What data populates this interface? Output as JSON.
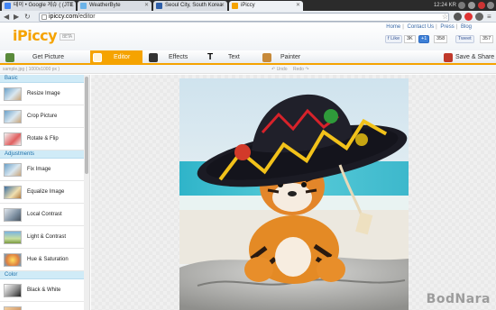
{
  "browser": {
    "tabs": [
      {
        "label": "테이 • Google 게슈 ( (JTE",
        "active": false,
        "fav_color": "#4285f4"
      },
      {
        "label": "WeatherByte",
        "active": false,
        "fav_color": "#6bb3e8"
      },
      {
        "label": "Seoul City, South Korea",
        "active": false,
        "fav_color": "#2f5fa8"
      },
      {
        "label": "iPiccy",
        "active": true,
        "fav_color": "#f5a300"
      }
    ],
    "clock": "12:24 KR",
    "url_domain": "ipiccy.com",
    "url_path": "/editor"
  },
  "app": {
    "logo": "iPiccy",
    "beta": "BETA",
    "links": [
      "Home",
      "Contact Us",
      "Press",
      "Blog"
    ],
    "social": {
      "like": "Like",
      "like_count": "3K",
      "plus": "+1",
      "plus_count": "358",
      "tweet": "Tweet",
      "tweet_count": "357"
    },
    "nav": [
      {
        "label": "Get Picture",
        "active": false,
        "icon": "picture-icon"
      },
      {
        "label": "Editor",
        "active": true,
        "icon": "editor-icon"
      },
      {
        "label": "Effects",
        "active": false,
        "icon": "effects-icon"
      },
      {
        "label": "Text",
        "active": false,
        "icon": "text-icon"
      },
      {
        "label": "Painter",
        "active": false,
        "icon": "painter-icon"
      }
    ],
    "save_share": "Save & Share",
    "file_info": "sample.jpg ( 1000x1000 px )",
    "undo": "Undo",
    "redo": "Redo",
    "accent_color": "#f5a300"
  },
  "sidebar": {
    "sections": [
      {
        "title": "Basic",
        "tools": [
          "Resize Image",
          "Crop Picture",
          "Rotate & Flip"
        ]
      },
      {
        "title": "Adjustments",
        "tools": [
          "Fix Image",
          "Equalize Image",
          "Local Contrast",
          "Light & Contrast",
          "Hue & Saturation"
        ]
      },
      {
        "title": "Color",
        "tools": [
          "Black & White"
        ]
      }
    ]
  },
  "watermark": "BodNara"
}
